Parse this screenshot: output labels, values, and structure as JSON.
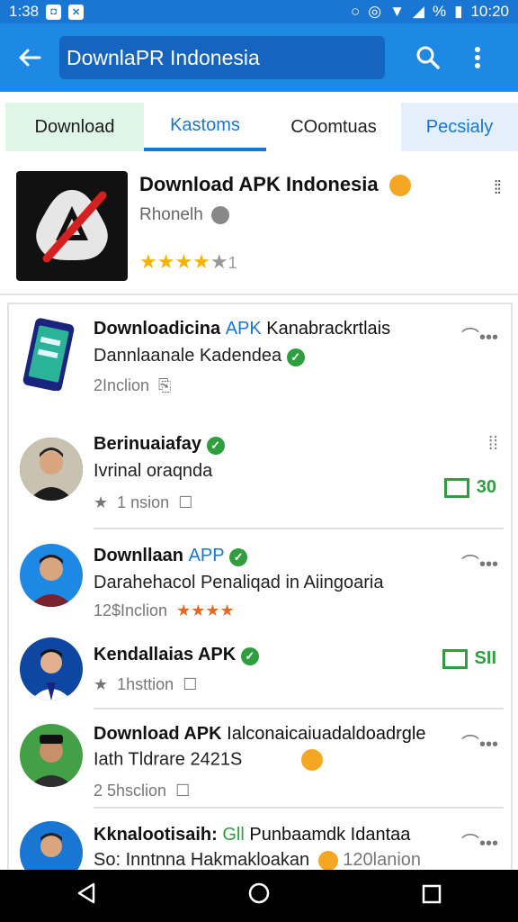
{
  "status_bar": {
    "time": "1:38",
    "right_percent": "%",
    "clock": "10:20"
  },
  "toolbar": {
    "search_value": "DownlaPR Indonesia"
  },
  "tabs": [
    "Download",
    "Kastoms",
    "COomtuas",
    "Pecsialy"
  ],
  "featured": {
    "title": "Download APK Indonesia",
    "subtitle": "Rhonelh",
    "rating_count": "1"
  },
  "items": [
    {
      "title": "Downloadicina",
      "title_accent": "APK",
      "title_rest": "Kanabrackrtlais",
      "line2": "Dannlaanale Kadendea",
      "meta": "2Inclion"
    },
    {
      "title": "Berinuaiafay",
      "line2": "Ivrinal oraqnda",
      "meta": "1 nsion",
      "side_value": "30"
    },
    {
      "title": "Downllaan",
      "title_accent": "APP",
      "line2": "Darahehacol Penaliqad in Aiingoaria",
      "meta": "12$Inclion"
    },
    {
      "title": "Kendallaias APK",
      "line2": "",
      "meta": "1hsttion",
      "side_value": "SII"
    },
    {
      "title": "Download APK",
      "title_rest": "Ialconaicaiuadaldoadrgle",
      "line2": "Iath Tldrare 2421S",
      "meta": "2 5hsclion"
    },
    {
      "title": "Kknalootisaih:",
      "title_accent": "Gll",
      "title_rest": "Punbaamdk Idantaa",
      "line2": "So: Inntnna Hakmakloakan",
      "meta": "120lanion"
    }
  ]
}
